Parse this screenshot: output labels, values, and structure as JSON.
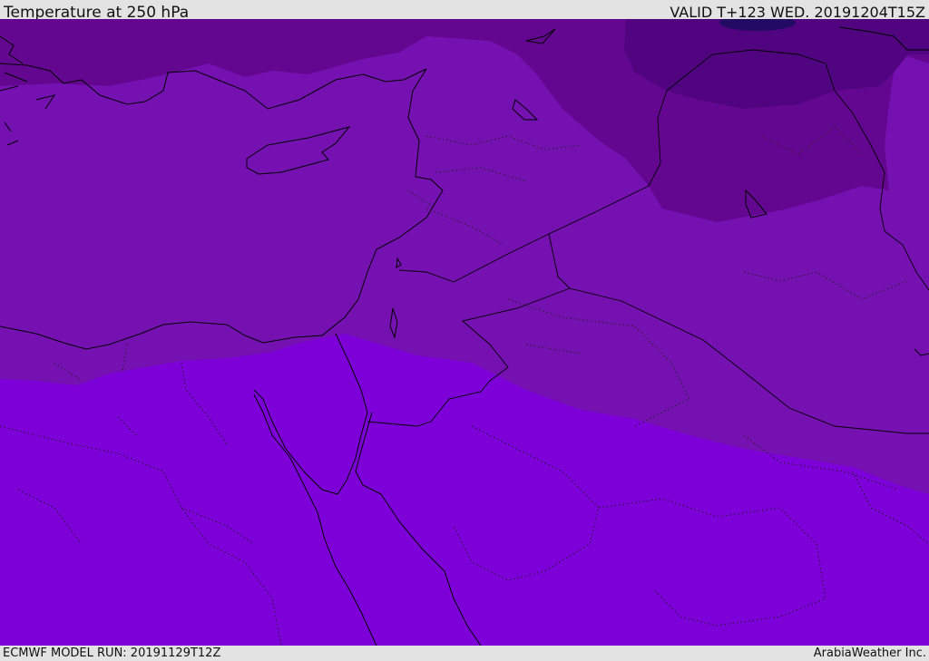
{
  "header": {
    "title": "Temperature at 250 hPa",
    "valid": "VALID T+123 WED. 20191204T15Z"
  },
  "footer": {
    "model_run": "ECMWF MODEL RUN: 20191129T12Z",
    "brand": "ArabiaWeather Inc."
  },
  "map": {
    "parameter": "Temperature",
    "level": "250 hPa",
    "colors": {
      "coldest": "#230a63",
      "very_cold": "#51047f",
      "cold": "#630690",
      "mid": "#7411b0",
      "warm": "#7d00d9"
    },
    "icons": [
      "coastline-outline",
      "country-border-line",
      "province-border-dotted"
    ]
  }
}
